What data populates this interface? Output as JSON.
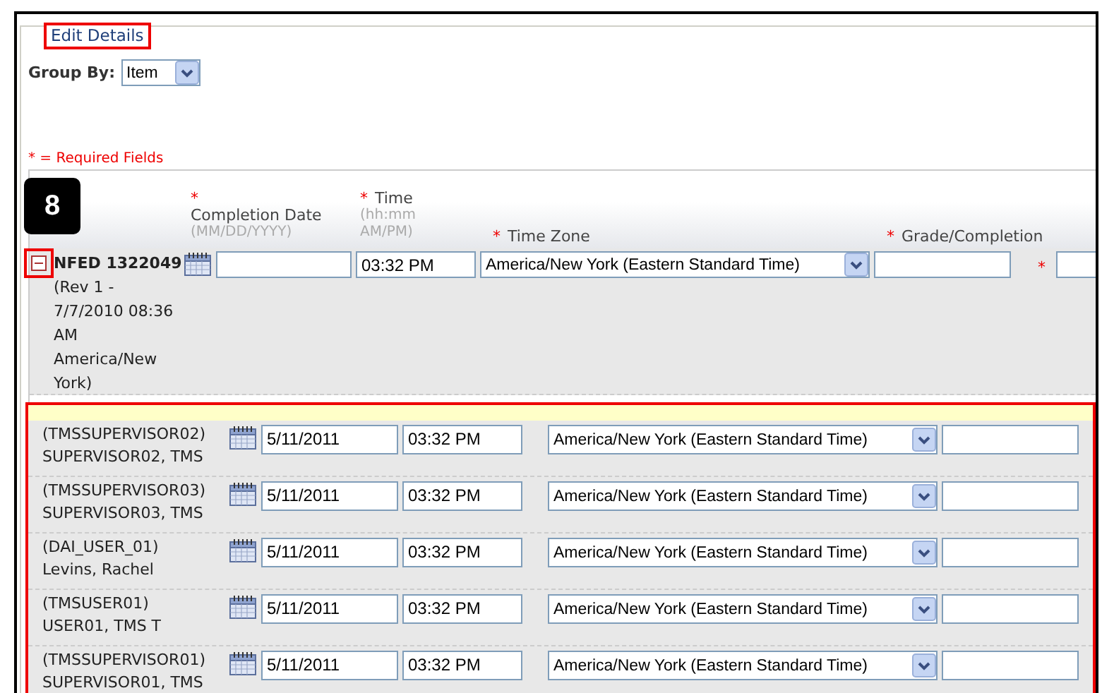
{
  "legend": {
    "label": "Edit Details",
    "highlighted": true
  },
  "group_by": {
    "label": "Group By:",
    "value": "Item"
  },
  "required_note": "* = Required Fields",
  "columns": [
    {
      "marker": "*",
      "label": "Completion Date",
      "hint": "(MM/DD/YYYY)"
    },
    {
      "marker": "*",
      "label": "Time",
      "hint": "(hh:mm AM/PM)"
    },
    {
      "marker": "*",
      "label": "Time Zone"
    },
    {
      "marker": "*",
      "label": "Grade/Completion"
    }
  ],
  "callout": "8",
  "item": {
    "title": "NFED 1322049",
    "detail": "(Rev 1 - 7/7/2010 08:36 AM America/New York)",
    "expanded": true,
    "highlighted": true,
    "time": "03:32 PM",
    "time_zone": "America/New York (Eastern Standard Time)",
    "extra_marker": "*"
  },
  "users_highlighted": true,
  "users": [
    {
      "id": "(TMSSUPERVISOR02)",
      "name": "SUPERVISOR02, TMS",
      "date": "5/11/2011",
      "time": "03:32 PM",
      "time_zone": "America/New York (Eastern Standard Time)"
    },
    {
      "id": "(TMSSUPERVISOR03)",
      "name": "SUPERVISOR03, TMS",
      "date": "5/11/2011",
      "time": "03:32 PM",
      "time_zone": "America/New York (Eastern Standard Time)"
    },
    {
      "id": "(DAI_USER_01)",
      "name": "Levins, Rachel",
      "date": "5/11/2011",
      "time": "03:32 PM",
      "time_zone": "America/New York (Eastern Standard Time)"
    },
    {
      "id": "(TMSUSER01)",
      "name": "USER01, TMS T",
      "date": "5/11/2011",
      "time": "03:32 PM",
      "time_zone": "America/New York (Eastern Standard Time)"
    },
    {
      "id": "(TMSSUPERVISOR01)",
      "name": "SUPERVISOR01, TMS",
      "date": "5/11/2011",
      "time": "03:32 PM",
      "time_zone": "America/New York (Eastern Standard Time)"
    }
  ]
}
